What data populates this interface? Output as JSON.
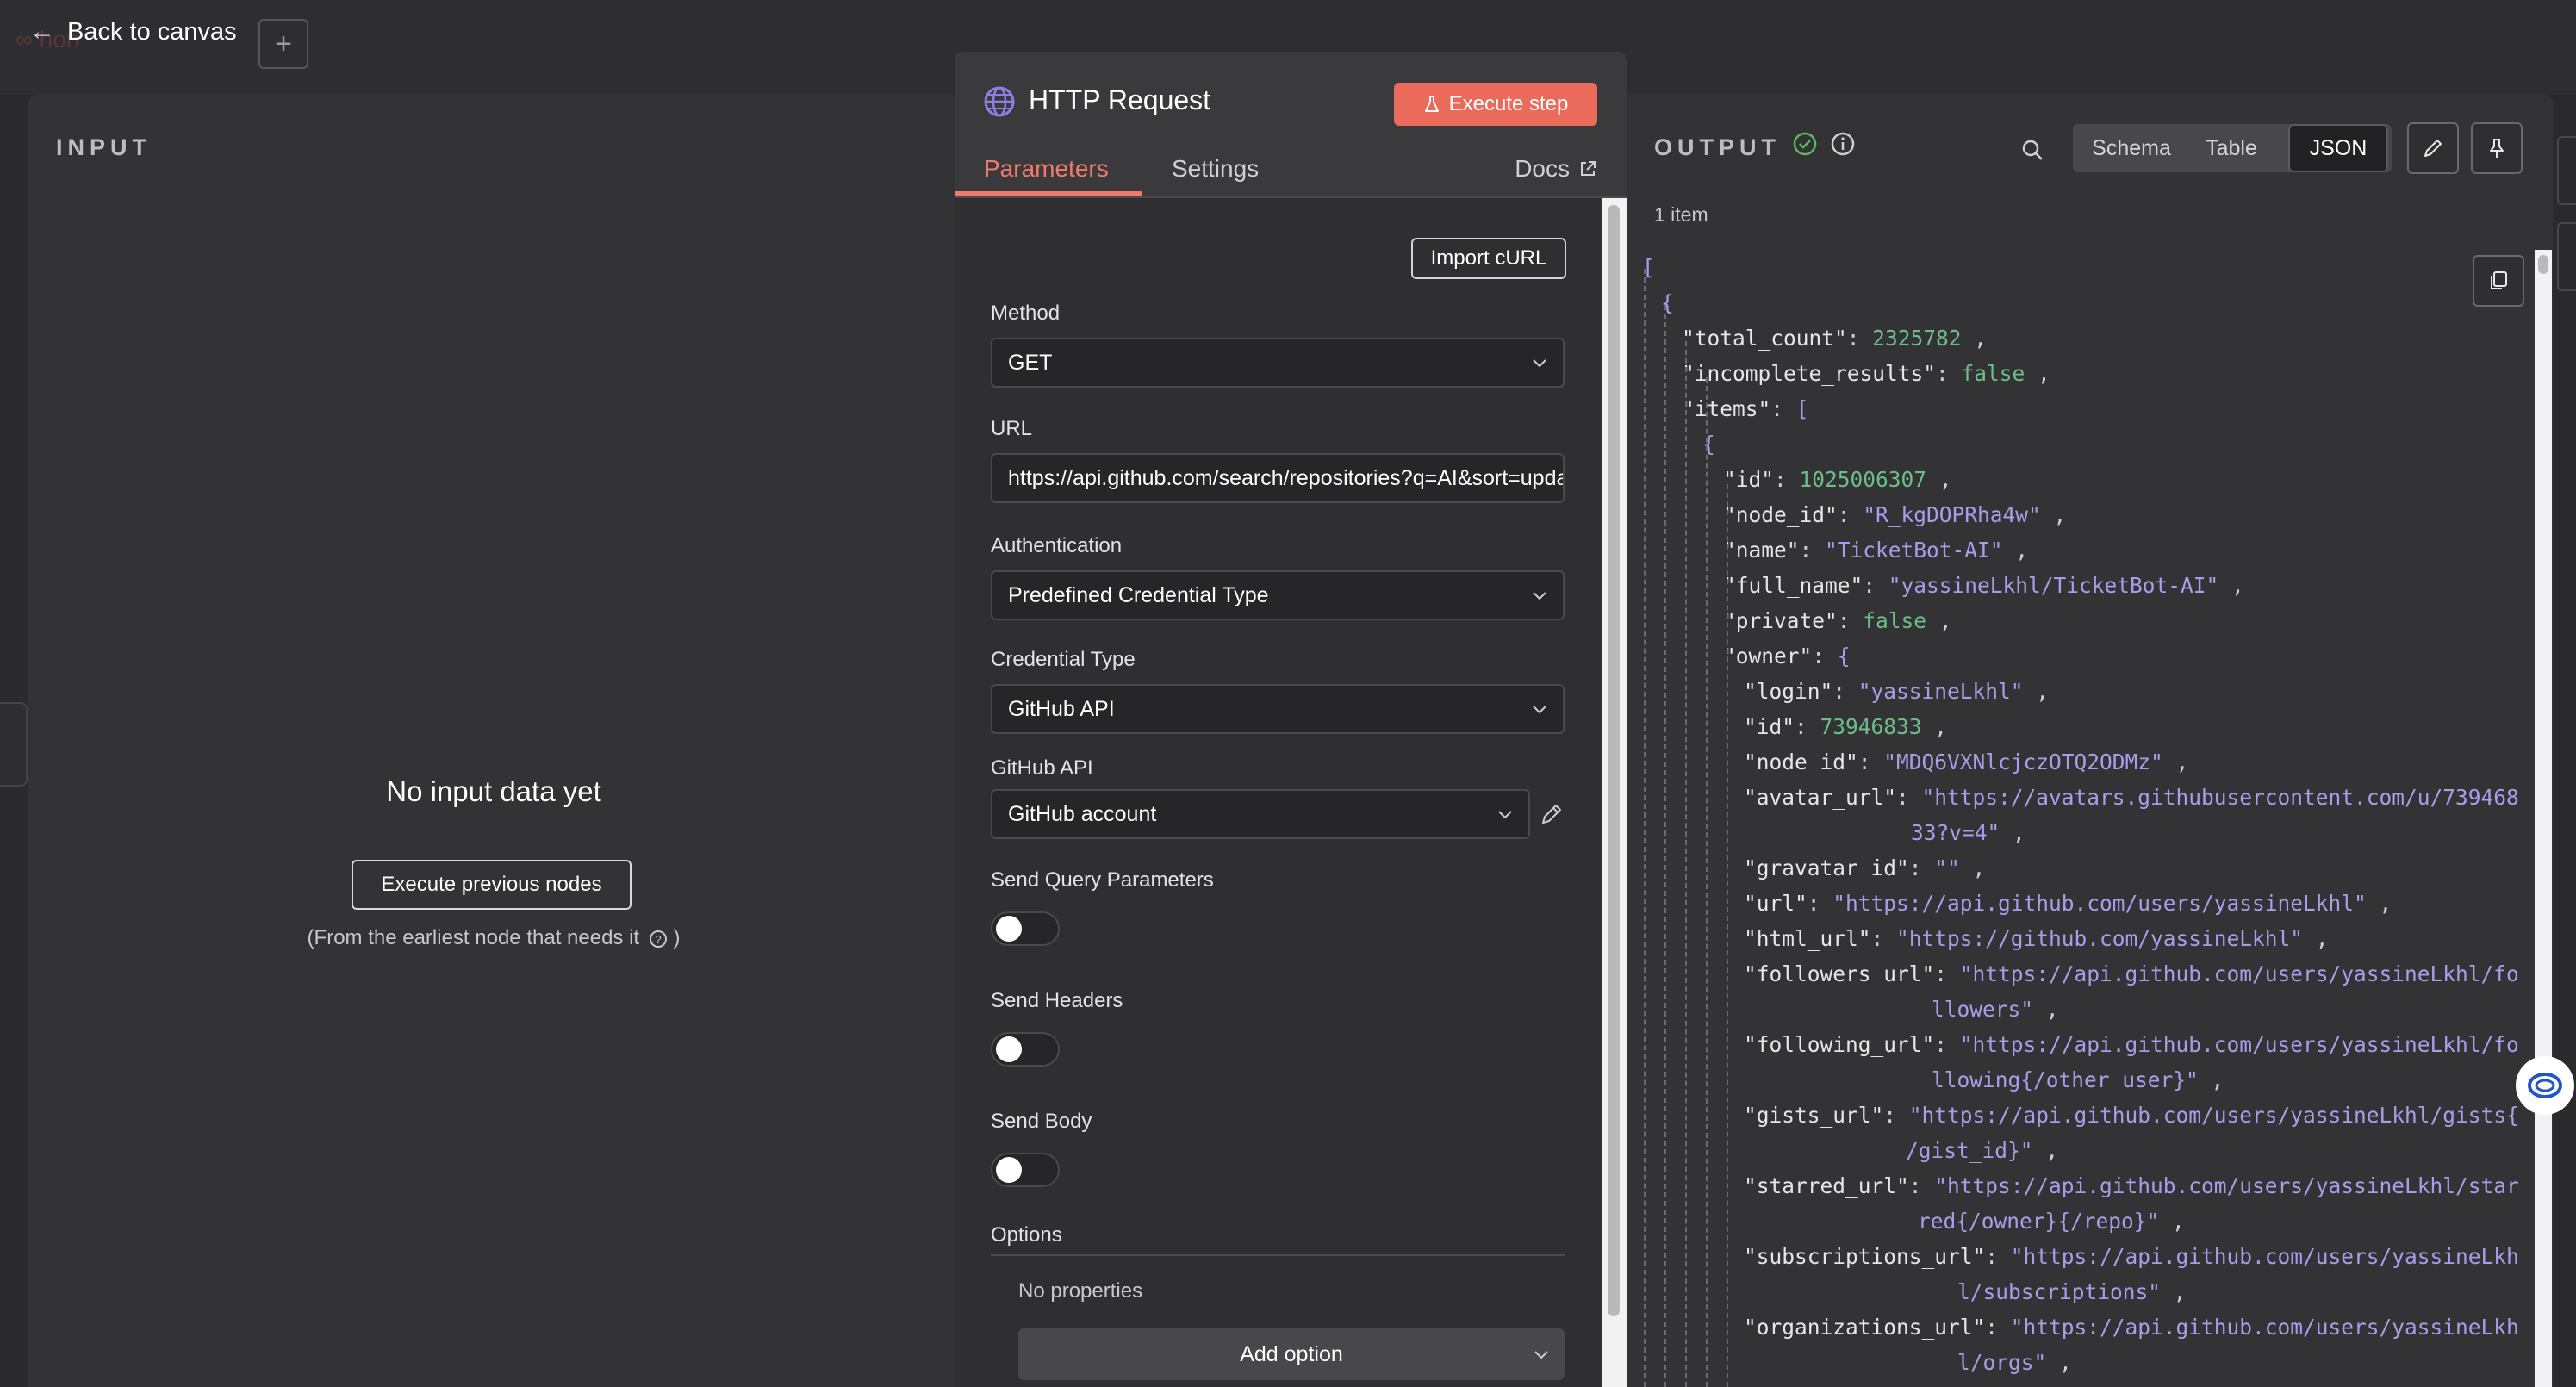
{
  "topbar": {
    "back_label": "Back to canvas",
    "back_arrow": "←",
    "plus_label": "+",
    "bg_word": "hon"
  },
  "input": {
    "heading": "INPUT",
    "empty_title": "No input data yet",
    "execute_prev_label": "Execute previous nodes",
    "note": "(From the earliest node that needs it",
    "note_close": ")"
  },
  "node": {
    "title": "HTTP Request",
    "execute_label": "Execute step",
    "tabs": [
      "Parameters",
      "Settings"
    ],
    "docs_label": "Docs",
    "import_curl_label": "Import cURL",
    "method": {
      "label": "Method",
      "value": "GET"
    },
    "url": {
      "label": "URL",
      "value": "https://api.github.com/search/repositories?q=AI&sort=updated"
    },
    "authentication": {
      "label": "Authentication",
      "value": "Predefined Credential Type"
    },
    "credential_type": {
      "label": "Credential Type",
      "value": "GitHub API"
    },
    "github_api": {
      "label": "GitHub API",
      "value": "GitHub account"
    },
    "send_query": {
      "label": "Send Query Parameters",
      "enabled": false
    },
    "send_headers": {
      "label": "Send Headers",
      "enabled": false
    },
    "send_body": {
      "label": "Send Body",
      "enabled": false
    },
    "options": {
      "label": "Options",
      "empty": "No properties",
      "add_label": "Add option"
    }
  },
  "output": {
    "heading": "OUTPUT",
    "views": [
      "Schema",
      "Table",
      "JSON"
    ],
    "active_view": "JSON",
    "items_count": "1 item",
    "json_lines": [
      {
        "parts": [
          [
            "jbr",
            "["
          ]
        ]
      },
      {
        "parts": [
          [
            "jbr",
            "{"
          ]
        ]
      },
      {
        "parts": [
          [
            "jk",
            "\"total_count\""
          ],
          [
            "jp",
            ": "
          ],
          [
            "jn",
            "2325782"
          ],
          [
            "jp",
            " ,"
          ]
        ]
      },
      {
        "parts": [
          [
            "jk",
            "\"incomplete_results\""
          ],
          [
            "jp",
            ": "
          ],
          [
            "jb",
            "false"
          ],
          [
            "jp",
            " ,"
          ]
        ]
      },
      {
        "parts": [
          [
            "jk",
            "\"items\""
          ],
          [
            "jp",
            ": "
          ],
          [
            "jbr",
            "["
          ]
        ]
      },
      {
        "parts": [
          [
            "jbr",
            "{"
          ]
        ]
      },
      {
        "parts": [
          [
            "jk",
            "\"id\""
          ],
          [
            "jp",
            ": "
          ],
          [
            "jn",
            "1025006307"
          ],
          [
            "jp",
            " ,"
          ]
        ]
      },
      {
        "parts": [
          [
            "jk",
            "\"node_id\""
          ],
          [
            "jp",
            ": "
          ],
          [
            "js",
            "\"R_kgDOPRha4w\""
          ],
          [
            "jp",
            " ,"
          ]
        ]
      },
      {
        "parts": [
          [
            "jk",
            "\"name\""
          ],
          [
            "jp",
            ": "
          ],
          [
            "js",
            "\"TicketBot-AI\""
          ],
          [
            "jp",
            " ,"
          ]
        ]
      },
      {
        "parts": [
          [
            "jk",
            "\"full_name\""
          ],
          [
            "jp",
            ": "
          ],
          [
            "js",
            "\"yassineLkhl/TicketBot-AI\""
          ],
          [
            "jp",
            " ,"
          ]
        ]
      },
      {
        "parts": [
          [
            "jk",
            "\"private\""
          ],
          [
            "jp",
            ": "
          ],
          [
            "jb",
            "false"
          ],
          [
            "jp",
            " ,"
          ]
        ]
      },
      {
        "parts": [
          [
            "jk",
            "\"owner\""
          ],
          [
            "jp",
            ": "
          ],
          [
            "jbr",
            "{"
          ]
        ]
      },
      {
        "parts": [
          [
            "jk",
            "\"login\""
          ],
          [
            "jp",
            ": "
          ],
          [
            "js",
            "\"yassineLkhl\""
          ],
          [
            "jp",
            " ,"
          ]
        ]
      },
      {
        "parts": [
          [
            "jk",
            "\"id\""
          ],
          [
            "jp",
            ": "
          ],
          [
            "jn",
            "73946833"
          ],
          [
            "jp",
            " ,"
          ]
        ]
      },
      {
        "parts": [
          [
            "jk",
            "\"node_id\""
          ],
          [
            "jp",
            ": "
          ],
          [
            "js",
            "\"MDQ6VXNlcjczOTQ2ODMz\""
          ],
          [
            "jp",
            " ,"
          ]
        ]
      },
      {
        "parts": [
          [
            "jk",
            "\"avatar_url\""
          ],
          [
            "jp",
            ": "
          ],
          [
            "js",
            "\"https://avatars.githubusercontent.com/u/739468"
          ]
        ]
      },
      {
        "parts": [
          [
            "js",
            "33?v=4\""
          ],
          [
            "jp",
            " ,"
          ]
        ]
      },
      {
        "parts": [
          [
            "jk",
            "\"gravatar_id\""
          ],
          [
            "jp",
            ": "
          ],
          [
            "js",
            "\"\""
          ],
          [
            "jp",
            " ,"
          ]
        ]
      },
      {
        "parts": [
          [
            "jk",
            "\"url\""
          ],
          [
            "jp",
            ": "
          ],
          [
            "js",
            "\"https://api.github.com/users/yassineLkhl\""
          ],
          [
            "jp",
            " ,"
          ]
        ]
      },
      {
        "parts": [
          [
            "jk",
            "\"html_url\""
          ],
          [
            "jp",
            ": "
          ],
          [
            "js",
            "\"https://github.com/yassineLkhl\""
          ],
          [
            "jp",
            " ,"
          ]
        ]
      },
      {
        "parts": [
          [
            "jk",
            "\"followers_url\""
          ],
          [
            "jp",
            ": "
          ],
          [
            "js",
            "\"https://api.github.com/users/yassineLkhl/fo"
          ]
        ]
      },
      {
        "parts": [
          [
            "js",
            "llowers\""
          ],
          [
            "jp",
            " ,"
          ]
        ]
      },
      {
        "parts": [
          [
            "jk",
            "\"following_url\""
          ],
          [
            "jp",
            ": "
          ],
          [
            "js",
            "\"https://api.github.com/users/yassineLkhl/fo"
          ]
        ]
      },
      {
        "parts": [
          [
            "js",
            "llowing{/other_user}\""
          ],
          [
            "jp",
            " ,"
          ]
        ]
      },
      {
        "parts": [
          [
            "jk",
            "\"gists_url\""
          ],
          [
            "jp",
            ": "
          ],
          [
            "js",
            "\"https://api.github.com/users/yassineLkhl/gists{"
          ]
        ]
      },
      {
        "parts": [
          [
            "js",
            "/gist_id}\""
          ],
          [
            "jp",
            " ,"
          ]
        ]
      },
      {
        "parts": [
          [
            "jk",
            "\"starred_url\""
          ],
          [
            "jp",
            ": "
          ],
          [
            "js",
            "\"https://api.github.com/users/yassineLkhl/star"
          ]
        ]
      },
      {
        "parts": [
          [
            "js",
            "red{/owner}{/repo}\""
          ],
          [
            "jp",
            " ,"
          ]
        ]
      },
      {
        "parts": [
          [
            "jk",
            "\"subscriptions_url\""
          ],
          [
            "jp",
            ": "
          ],
          [
            "js",
            "\"https://api.github.com/users/yassineLkh"
          ]
        ]
      },
      {
        "parts": [
          [
            "js",
            "l/subscriptions\""
          ],
          [
            "jp",
            " ,"
          ]
        ]
      },
      {
        "parts": [
          [
            "jk",
            "\"organizations_url\""
          ],
          [
            "jp",
            ": "
          ],
          [
            "js",
            "\"https://api.github.com/users/yassineLkh"
          ]
        ]
      },
      {
        "parts": [
          [
            "js",
            "l/orgs\""
          ],
          [
            "jp",
            " ,"
          ]
        ]
      }
    ]
  },
  "colors": {
    "accent": "#ea6b5c",
    "tab_active": "#f07b6b",
    "json_string": "#a99ce8",
    "json_number": "#6dbd88",
    "success": "#5cb85c"
  },
  "icons": [
    "back-arrow-icon",
    "plus-icon",
    "globe-icon",
    "flask-icon",
    "external-link-icon",
    "chevron-down-icon",
    "pencil-icon",
    "check-circle-icon",
    "info-icon",
    "search-icon",
    "edit-icon",
    "pin-icon",
    "copy-icon",
    "chat-icon",
    "help-icon"
  ]
}
